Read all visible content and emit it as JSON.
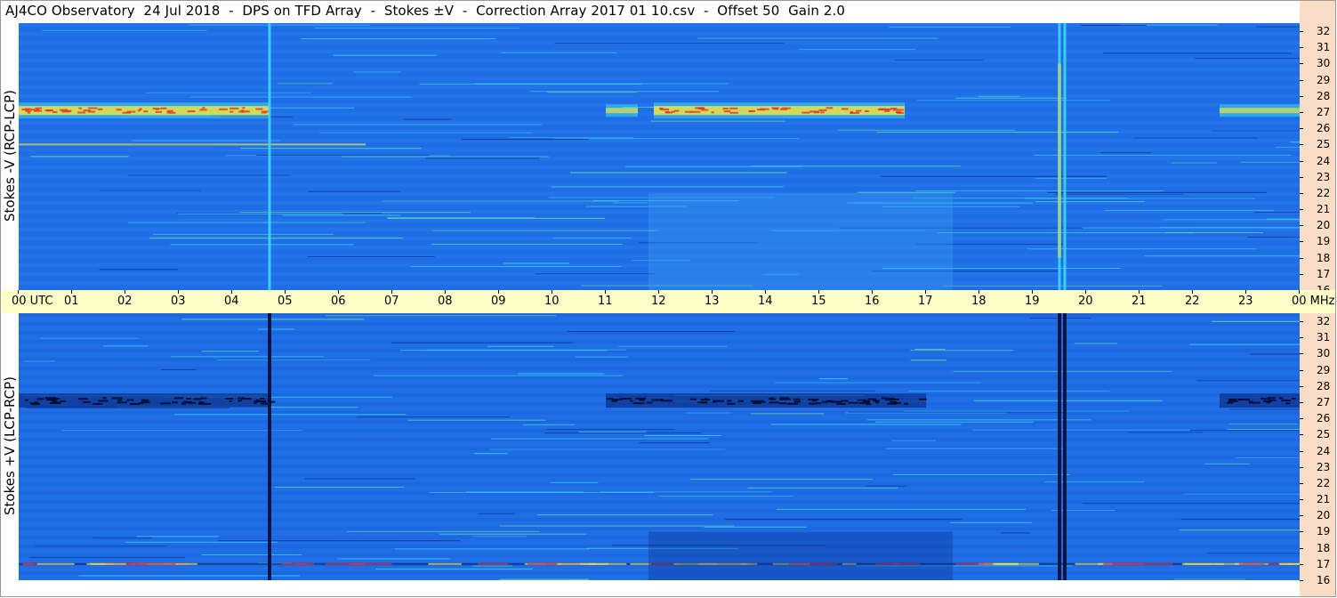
{
  "title": "AJ4CO Observatory  24 Jul 2018  -  DPS on TFD Array  -  Stokes ±V  -  Correction Array 2017 01 10.csv  -  Offset 50  Gain 2.0",
  "panels": {
    "top_label": "Stokes -V (RCP-LCP)",
    "bottom_label": "Stokes +V (LCP-RCP)"
  },
  "time_axis": {
    "labels": [
      "00 UTC",
      "01",
      "02",
      "03",
      "04",
      "05",
      "06",
      "07",
      "08",
      "09",
      "10",
      "11",
      "12",
      "13",
      "14",
      "15",
      "16",
      "17",
      "18",
      "19",
      "20",
      "21",
      "22",
      "23",
      "00 MHz"
    ]
  },
  "freq_axis": {
    "labels": [
      "32",
      "31",
      "30",
      "29",
      "28",
      "27",
      "26",
      "25",
      "24",
      "23",
      "22",
      "21",
      "20",
      "19",
      "18",
      "17",
      "16"
    ],
    "unit": "MHz"
  },
  "colors": {
    "bg_blue": "#1f6ee6",
    "deep_blue": "#0a2f8a",
    "cyan": "#38d8f0",
    "yellow": "#f0e040",
    "red": "#e83030",
    "axis_bg": "#ffffc8",
    "strip_bg": "#fbdcc4"
  },
  "chart_data": {
    "type": "heatmap",
    "title": "AJ4CO Observatory  24 Jul 2018  -  DPS on TFD Array  -  Stokes ±V  -  Correction Array 2017 01 10.csv  -  Offset 50  Gain 2.0",
    "x_range_utc_hours": [
      0,
      24
    ],
    "y_range_mhz": [
      16,
      32.5
    ],
    "panels": [
      {
        "name": "Stokes -V (RCP-LCP)",
        "emission_bands": [
          {
            "mhz": 27.1,
            "utc": [
              0.0,
              4.7
            ],
            "intensity": "high"
          },
          {
            "mhz": 27.1,
            "utc": [
              11.0,
              11.6
            ],
            "intensity": "medium"
          },
          {
            "mhz": 27.1,
            "utc": [
              11.9,
              16.6
            ],
            "intensity": "high"
          },
          {
            "mhz": 27.1,
            "utc": [
              22.5,
              24.0
            ],
            "intensity": "medium"
          },
          {
            "mhz": 25.0,
            "utc": [
              0.0,
              6.5
            ],
            "intensity": "low"
          }
        ],
        "vertical_features": [
          {
            "utc": 4.7,
            "kind": "bright"
          },
          {
            "utc": 19.5,
            "kind": "bright"
          },
          {
            "utc": 19.6,
            "kind": "bright"
          }
        ]
      },
      {
        "name": "Stokes +V (LCP-RCP)",
        "emission_bands": [
          {
            "mhz": 27.1,
            "utc": [
              0.0,
              4.7
            ],
            "intensity": "absorption"
          },
          {
            "mhz": 27.1,
            "utc": [
              11.0,
              17.0
            ],
            "intensity": "absorption"
          },
          {
            "mhz": 27.1,
            "utc": [
              22.5,
              24.0
            ],
            "intensity": "absorption"
          },
          {
            "mhz": 17.0,
            "utc": [
              0.0,
              24.0
            ],
            "intensity": "mixed"
          }
        ],
        "vertical_features": [
          {
            "utc": 4.7,
            "kind": "dark"
          },
          {
            "utc": 19.5,
            "kind": "dark"
          },
          {
            "utc": 19.6,
            "kind": "dark"
          }
        ]
      }
    ]
  }
}
